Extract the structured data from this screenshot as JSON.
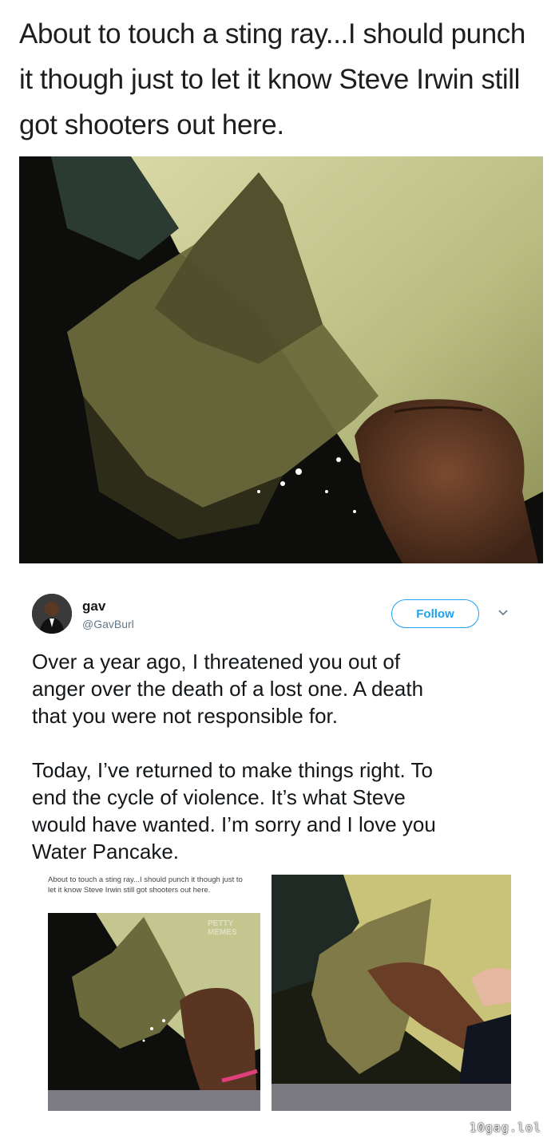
{
  "original_post": {
    "caption": "About to touch a sting ray...I should punch it though just to let it know Steve Irwin still got shooters out here."
  },
  "tweet": {
    "display_name": "gav",
    "handle": "@GavBurl",
    "follow_label": "Follow",
    "paragraph_1": "Over a year ago, I threatened you out of\nanger over the death of a lost one. A death\nthat you were not responsible for.",
    "paragraph_2": "Today, I’ve returned to make things right. To\nend the cycle of violence. It’s what Steve\nwould have wanted. I’m sorry and I love you\nWater Pancake."
  },
  "media": {
    "left_caption": "About to touch a sting ray...I should punch it though just to let it know Steve Irwin still got shooters out here.",
    "left_watermark": "PETTY MEMES"
  },
  "site_watermark": "10gag.lol",
  "icons": {
    "follow_chevron": "chevron-down-icon"
  },
  "colors": {
    "accent": "#1da1f2",
    "handle": "#657786",
    "text": "#14171a"
  }
}
